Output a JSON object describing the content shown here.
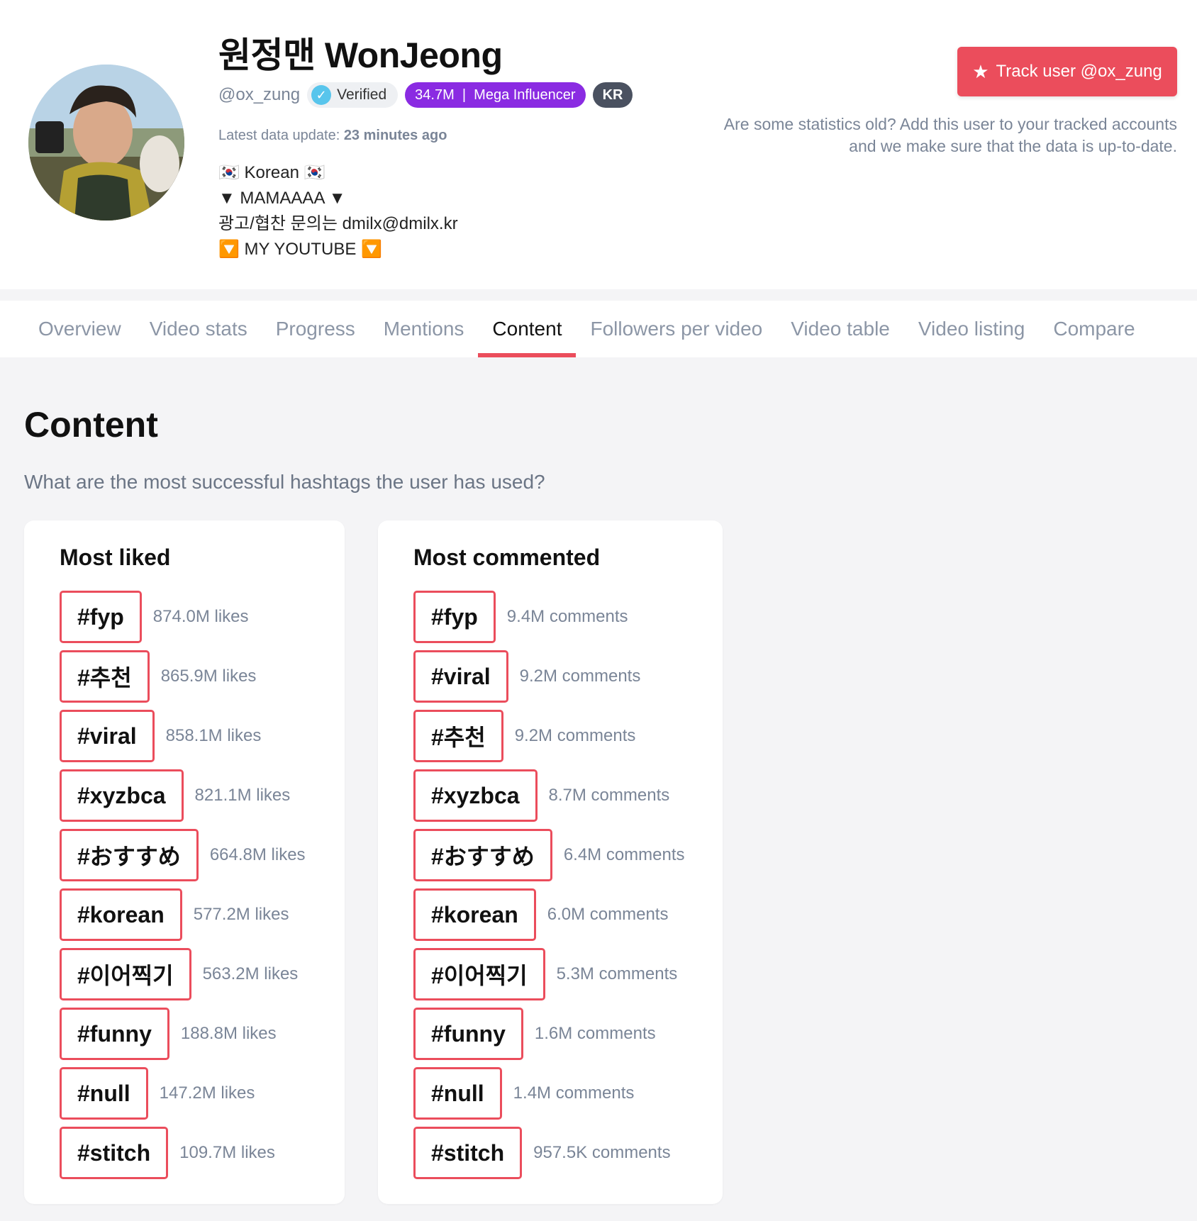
{
  "profile": {
    "name": "원정맨 WonJeong",
    "handle": "@ox_zung",
    "verified_label": "Verified",
    "followers_badge": "34.7M  |  Mega Influencer",
    "country": "KR",
    "update_label": "Latest data update:",
    "update_value": "23 minutes ago",
    "bio": [
      "🇰🇷 Korean 🇰🇷",
      "▼ MAMAAAA ▼",
      "광고/협찬 문의는 dmilx@dmilx.kr",
      "🔽 MY YOUTUBE 🔽"
    ]
  },
  "track": {
    "button_label": "Track user @ox_zung",
    "note_line1": "Are some statistics old? Add this user to your tracked accounts",
    "note_line2": "and we make sure that the data is up-to-date."
  },
  "tabs": [
    {
      "label": "Overview"
    },
    {
      "label": "Video stats"
    },
    {
      "label": "Progress"
    },
    {
      "label": "Mentions"
    },
    {
      "label": "Content"
    },
    {
      "label": "Followers per video"
    },
    {
      "label": "Video table"
    },
    {
      "label": "Video listing"
    },
    {
      "label": "Compare"
    }
  ],
  "active_tab": "Content",
  "content": {
    "title": "Content",
    "subtitle": "What are the most successful hashtags the user has used?"
  },
  "most_liked": {
    "title": "Most liked",
    "items": [
      {
        "tag": "#fyp",
        "value": "874.0M likes"
      },
      {
        "tag": "#추천",
        "value": "865.9M likes"
      },
      {
        "tag": "#viral",
        "value": "858.1M likes"
      },
      {
        "tag": "#xyzbca",
        "value": "821.1M likes"
      },
      {
        "tag": "#おすすめ",
        "value": "664.8M likes"
      },
      {
        "tag": "#korean",
        "value": "577.2M likes"
      },
      {
        "tag": "#이어찍기",
        "value": "563.2M likes"
      },
      {
        "tag": "#funny",
        "value": "188.8M likes"
      },
      {
        "tag": "#null",
        "value": "147.2M likes"
      },
      {
        "tag": "#stitch",
        "value": "109.7M likes"
      }
    ]
  },
  "most_commented": {
    "title": "Most commented",
    "items": [
      {
        "tag": "#fyp",
        "value": "9.4M comments"
      },
      {
        "tag": "#viral",
        "value": "9.2M comments"
      },
      {
        "tag": "#추천",
        "value": "9.2M comments"
      },
      {
        "tag": "#xyzbca",
        "value": "8.7M comments"
      },
      {
        "tag": "#おすすめ",
        "value": "6.4M comments"
      },
      {
        "tag": "#korean",
        "value": "6.0M comments"
      },
      {
        "tag": "#이어찍기",
        "value": "5.3M comments"
      },
      {
        "tag": "#funny",
        "value": "1.6M comments"
      },
      {
        "tag": "#null",
        "value": "1.4M comments"
      },
      {
        "tag": "#stitch",
        "value": "957.5K comments"
      }
    ]
  },
  "colors": {
    "accent": "#eb4d5c",
    "mega_badge": "#8a2be2",
    "country_badge": "#4a5160",
    "verified_tick": "#58c5ec"
  }
}
